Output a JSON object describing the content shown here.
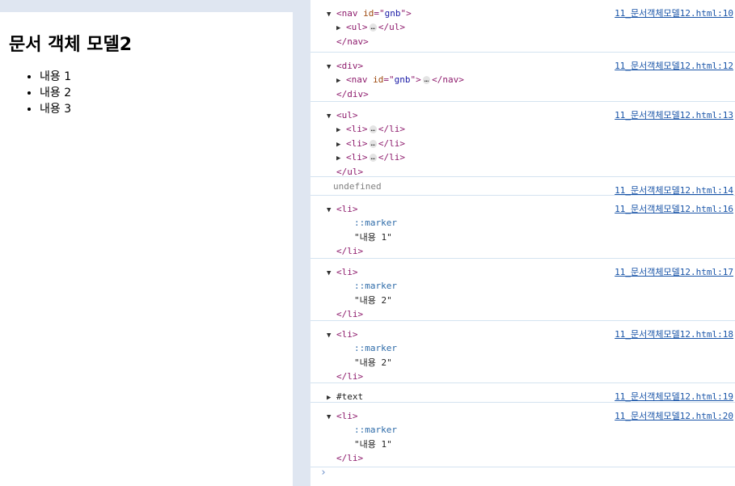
{
  "page": {
    "heading": "문서 객체 모델2",
    "items": [
      "내용 1",
      "내용 2",
      "내용 3"
    ]
  },
  "console": {
    "entries": [
      {
        "source": "11_문서객체모델12.html:10",
        "lines": [
          {
            "tri": "▼",
            "parts": [
              [
                "tag",
                "<nav "
              ],
              [
                "attr-name",
                "id"
              ],
              [
                "tag",
                "=\""
              ],
              [
                "attr-val",
                "gnb"
              ],
              [
                "tag",
                "\">"
              ]
            ]
          },
          {
            "tri": "▶",
            "parts": [
              [
                "tag",
                "<ul>"
              ],
              [
                "ell",
                "…"
              ],
              [
                "tag",
                "</ul>"
              ]
            ]
          },
          {
            "tri": "",
            "parts": [
              [
                "tag",
                "</nav>"
              ]
            ]
          }
        ]
      },
      {
        "source": "11_문서객체모델12.html:12",
        "lines": [
          {
            "tri": "▼",
            "parts": [
              [
                "tag",
                "<div>"
              ]
            ]
          },
          {
            "tri": "▶",
            "parts": [
              [
                "tag",
                "<nav "
              ],
              [
                "attr-name",
                "id"
              ],
              [
                "tag",
                "=\""
              ],
              [
                "attr-val",
                "gnb"
              ],
              [
                "tag",
                "\">"
              ],
              [
                "ell",
                "…"
              ],
              [
                "tag",
                "</nav>"
              ]
            ]
          },
          {
            "tri": "",
            "parts": [
              [
                "tag",
                "</div>"
              ]
            ]
          }
        ]
      },
      {
        "source": "11_문서객체모델12.html:13",
        "lines": [
          {
            "tri": "▼",
            "parts": [
              [
                "tag",
                "<ul>"
              ]
            ]
          },
          {
            "tri": "▶",
            "parts": [
              [
                "tag",
                "<li>"
              ],
              [
                "ell",
                "…"
              ],
              [
                "tag",
                "</li>"
              ]
            ]
          },
          {
            "tri": "▶",
            "parts": [
              [
                "tag",
                "<li>"
              ],
              [
                "ell",
                "…"
              ],
              [
                "tag",
                "</li>"
              ]
            ]
          },
          {
            "tri": "▶",
            "parts": [
              [
                "tag",
                "<li>"
              ],
              [
                "ell",
                "…"
              ],
              [
                "tag",
                "</li>"
              ]
            ]
          },
          {
            "tri": "",
            "parts": [
              [
                "tag",
                "</ul>"
              ]
            ]
          }
        ]
      },
      {
        "source": "11_문서객체모델12.html:14",
        "lines": [
          {
            "tri": "",
            "parts": [
              [
                "muted",
                "undefined"
              ]
            ]
          }
        ]
      },
      {
        "source": "11_문서객체모델12.html:16",
        "lines": [
          {
            "tri": "▼",
            "parts": [
              [
                "tag",
                "<li>"
              ]
            ]
          },
          {
            "tri": "",
            "parts": [
              [
                "pseudo",
                "::marker"
              ]
            ]
          },
          {
            "tri": "",
            "parts": [
              [
                "str",
                "\"내용 1\""
              ]
            ]
          },
          {
            "tri": "",
            "parts": [
              [
                "tag",
                "</li>"
              ]
            ]
          }
        ]
      },
      {
        "source": "11_문서객체모델12.html:17",
        "lines": [
          {
            "tri": "▼",
            "parts": [
              [
                "tag",
                "<li>"
              ]
            ]
          },
          {
            "tri": "",
            "parts": [
              [
                "pseudo",
                "::marker"
              ]
            ]
          },
          {
            "tri": "",
            "parts": [
              [
                "str",
                "\"내용 2\""
              ]
            ]
          },
          {
            "tri": "",
            "parts": [
              [
                "tag",
                "</li>"
              ]
            ]
          }
        ]
      },
      {
        "source": "11_문서객체모델12.html:18",
        "lines": [
          {
            "tri": "▼",
            "parts": [
              [
                "tag",
                "<li>"
              ]
            ]
          },
          {
            "tri": "",
            "parts": [
              [
                "pseudo",
                "::marker"
              ]
            ]
          },
          {
            "tri": "",
            "parts": [
              [
                "str",
                "\"내용 2\""
              ]
            ]
          },
          {
            "tri": "",
            "parts": [
              [
                "tag",
                "</li>"
              ]
            ]
          }
        ]
      },
      {
        "source": "11_문서객체모델12.html:19",
        "lines": [
          {
            "tri": "▶",
            "parts": [
              [
                "plain",
                "#text"
              ]
            ]
          }
        ]
      },
      {
        "source": "11_문서객체모델12.html:20",
        "lines": [
          {
            "tri": "▼",
            "parts": [
              [
                "tag",
                "<li>"
              ]
            ]
          },
          {
            "tri": "",
            "parts": [
              [
                "pseudo",
                "::marker"
              ]
            ]
          },
          {
            "tri": "",
            "parts": [
              [
                "str",
                "\"내용 1\""
              ]
            ]
          },
          {
            "tri": "",
            "parts": [
              [
                "tag",
                "</li>"
              ]
            ]
          }
        ]
      }
    ],
    "prompt": "›"
  }
}
